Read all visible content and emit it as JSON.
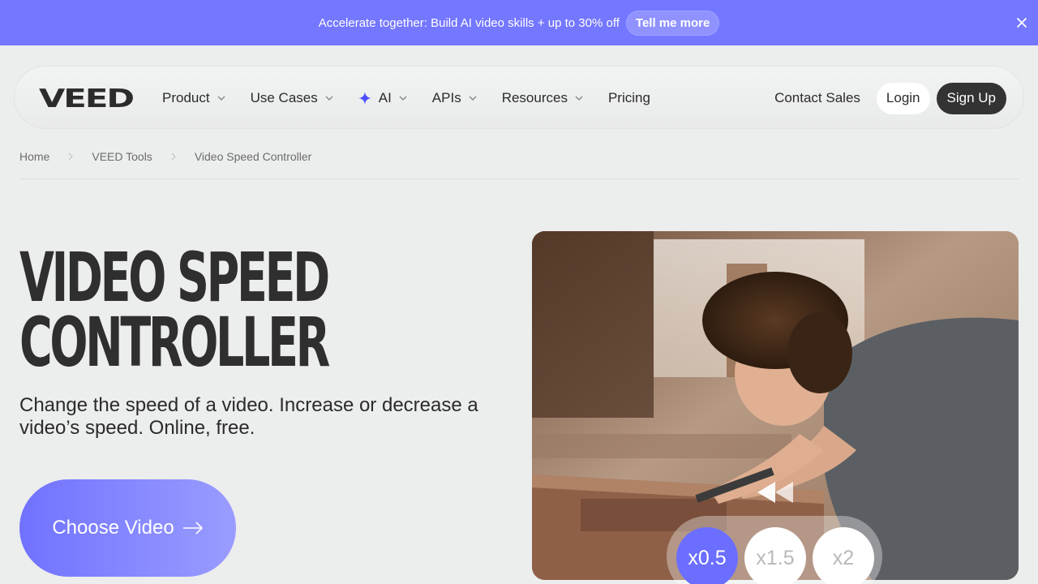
{
  "banner": {
    "text": "Accelerate together: Build AI video skills + up to 30% off",
    "button_label": "Tell me more",
    "close_icon": "close-icon",
    "bg_color": "#7477ff"
  },
  "nav": {
    "logo_text": "VEED",
    "items": [
      {
        "label": "Product",
        "has_dropdown": true
      },
      {
        "label": "Use Cases",
        "has_dropdown": true
      },
      {
        "label": "AI",
        "has_dropdown": true,
        "icon": "sparkle-icon"
      },
      {
        "label": "APIs",
        "has_dropdown": true
      },
      {
        "label": "Resources",
        "has_dropdown": true
      },
      {
        "label": "Pricing",
        "has_dropdown": false
      }
    ],
    "contact_label": "Contact Sales",
    "login_label": "Login",
    "signup_label": "Sign Up"
  },
  "breadcrumb": {
    "items": [
      "Home",
      "VEED Tools",
      "Video Speed Controller"
    ]
  },
  "hero": {
    "title_line1": "VIDEO SPEED",
    "title_line2": "CONTROLLER",
    "subtitle": "Change the speed of a video. Increase or decrease a video’s speed. Online, free.",
    "cta_label": "Choose Video"
  },
  "video_card": {
    "rewind_icon": "rewind-icon",
    "speeds": [
      {
        "label": "x0.5",
        "active": true
      },
      {
        "label": "x1.5",
        "active": false
      },
      {
        "label": "x2",
        "active": false
      }
    ],
    "accent_color": "#6b6eff"
  }
}
